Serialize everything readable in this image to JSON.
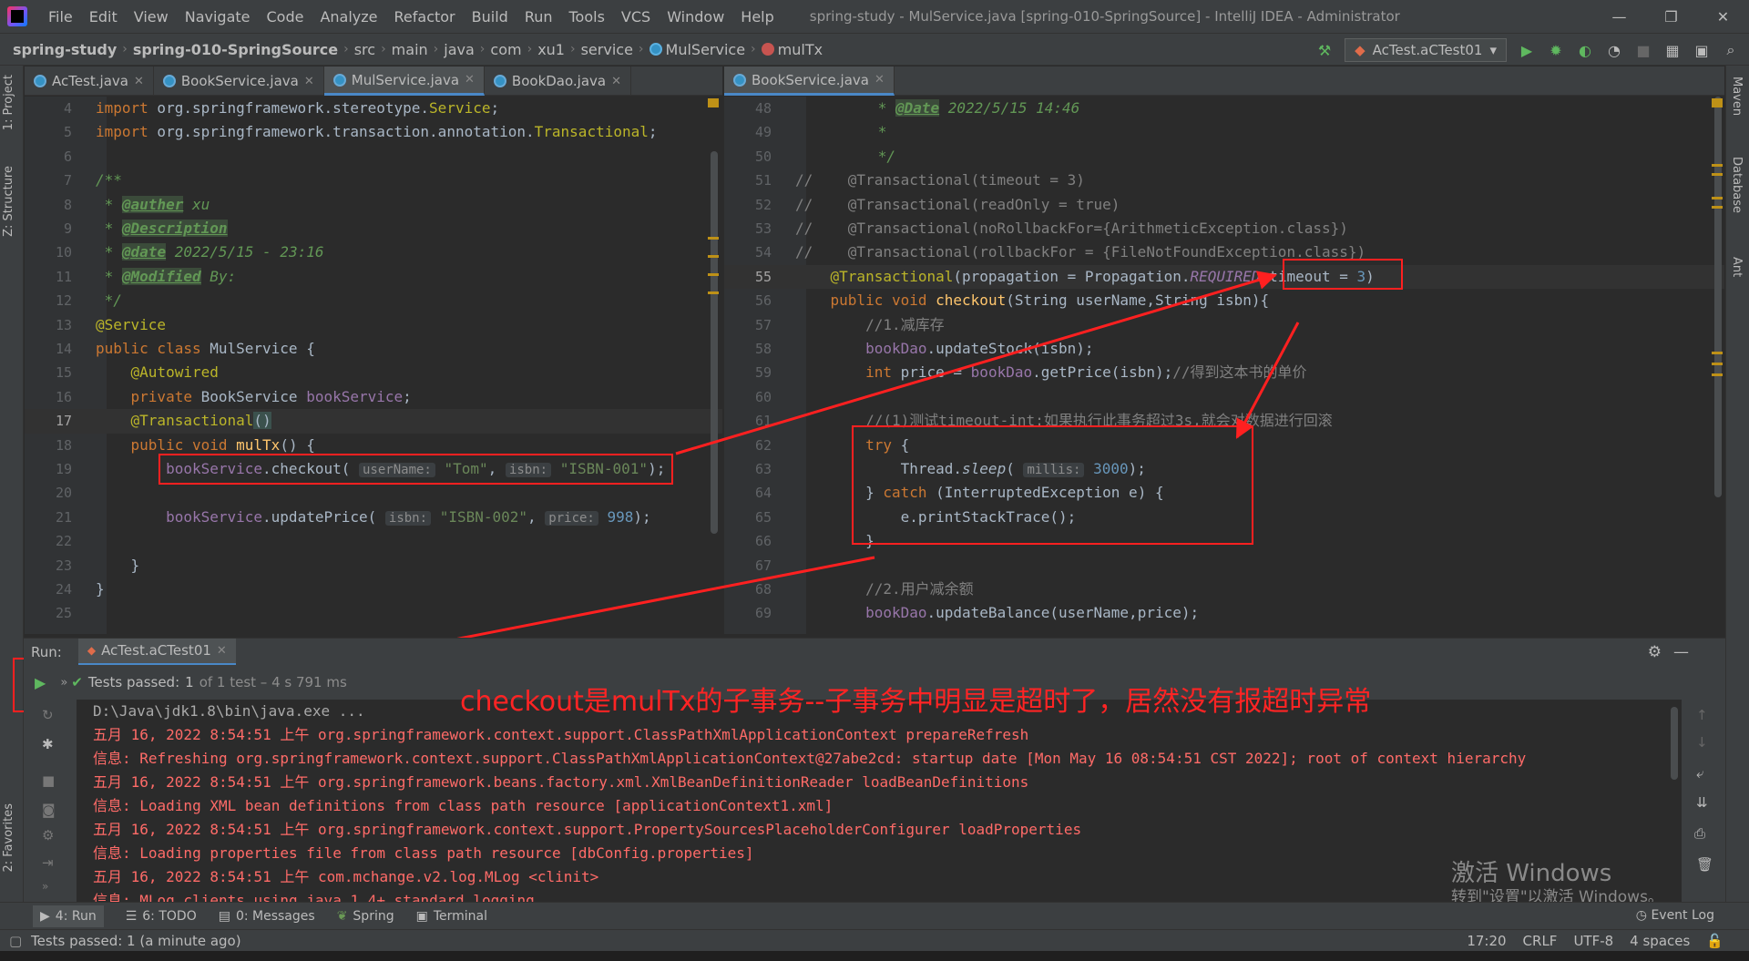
{
  "window": {
    "title": "spring-study - MulService.java [spring-010-SpringSource] - IntelliJ IDEA - Administrator",
    "menu": [
      "File",
      "Edit",
      "View",
      "Navigate",
      "Code",
      "Analyze",
      "Refactor",
      "Build",
      "Run",
      "Tools",
      "VCS",
      "Window",
      "Help"
    ],
    "controls": [
      "minimize-icon",
      "restore-icon",
      "close-icon"
    ]
  },
  "breadcrumb": [
    "spring-study",
    "spring-010-SpringSource",
    "src",
    "main",
    "java",
    "com",
    "xu1",
    "service",
    "MulService",
    "mulTx"
  ],
  "run_config": "AcTest.aCTest01",
  "left_tabs": [
    "AcTest.java",
    "BookService.java",
    "MulService.java",
    "BookDao.java"
  ],
  "right_tabs": [
    "BookService.java"
  ],
  "side_tools": {
    "left": [
      "1: Project",
      "Z: Structure",
      "2: Favorites"
    ],
    "right": [
      "Maven",
      "Database",
      "Ant"
    ]
  },
  "run_panel": {
    "label": "Run:",
    "tab": "AcTest.aCTest01",
    "status_prefix": "Tests passed:",
    "status_count": "1",
    "status_suffix": "of 1 test – 4 s 791 ms"
  },
  "console_lines": [
    {
      "text": "D:\\Java\\jdk1.8\\bin\\java.exe ...",
      "kind": "gray"
    },
    {
      "text": "五月 16, 2022 8:54:51 上午 org.springframework.context.support.ClassPathXmlApplicationContext prepareRefresh",
      "kind": "err"
    },
    {
      "text": "信息: Refreshing org.springframework.context.support.ClassPathXmlApplicationContext@27abe2cd: startup date [Mon May 16 08:54:51 CST 2022]; root of context hierarchy",
      "kind": "err"
    },
    {
      "text": "五月 16, 2022 8:54:51 上午 org.springframework.beans.factory.xml.XmlBeanDefinitionReader loadBeanDefinitions",
      "kind": "err"
    },
    {
      "text": "信息: Loading XML bean definitions from class path resource [applicationContext1.xml]",
      "kind": "err"
    },
    {
      "text": "五月 16, 2022 8:54:51 上午 org.springframework.context.support.PropertySourcesPlaceholderConfigurer loadProperties",
      "kind": "err"
    },
    {
      "text": "信息: Loading properties file from class path resource [dbConfig.properties]",
      "kind": "err"
    },
    {
      "text": "五月 16, 2022 8:54:51 上午 com.mchange.v2.log.MLog <clinit>",
      "kind": "err"
    },
    {
      "text": "信息: MLog clients using java 1.4+ standard logging.",
      "kind": "err"
    }
  ],
  "annotation_text": "checkout是mulTx的子事务--子事务中明显是超时了，居然没有报超时异常",
  "activate_windows": {
    "title": "激活 Windows",
    "subtitle": "转到\"设置\"以激活 Windows。"
  },
  "bottom_tabs": [
    "4: Run",
    "6: TODO",
    "0: Messages",
    "Spring",
    "Terminal"
  ],
  "event_log": "Event Log",
  "status": {
    "message": "Tests passed: 1 (a minute ago)",
    "position": "17:20",
    "line_sep": "CRLF",
    "encoding": "UTF-8",
    "indent": "4 spaces"
  },
  "colors": {
    "accent": "#4a88c7",
    "annotation": "#ff2020",
    "pass": "#5fb85f"
  }
}
